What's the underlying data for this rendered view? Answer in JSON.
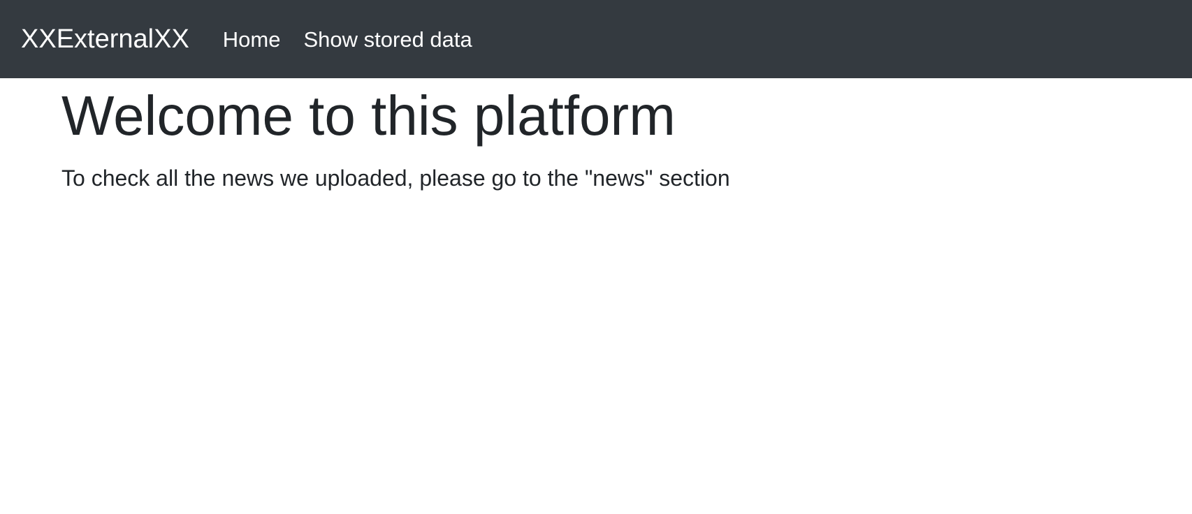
{
  "navbar": {
    "brand": "XXExternalXX",
    "links": [
      {
        "label": "Home"
      },
      {
        "label": "Show stored data"
      }
    ]
  },
  "main": {
    "title": "Welcome to this platform",
    "lead": "To check all the news we uploaded, please go to the \"news\" section"
  },
  "colors": {
    "navbar_bg": "#343a40",
    "nav_text": "#ffffff",
    "body_text": "#212529",
    "page_bg": "#ffffff"
  }
}
